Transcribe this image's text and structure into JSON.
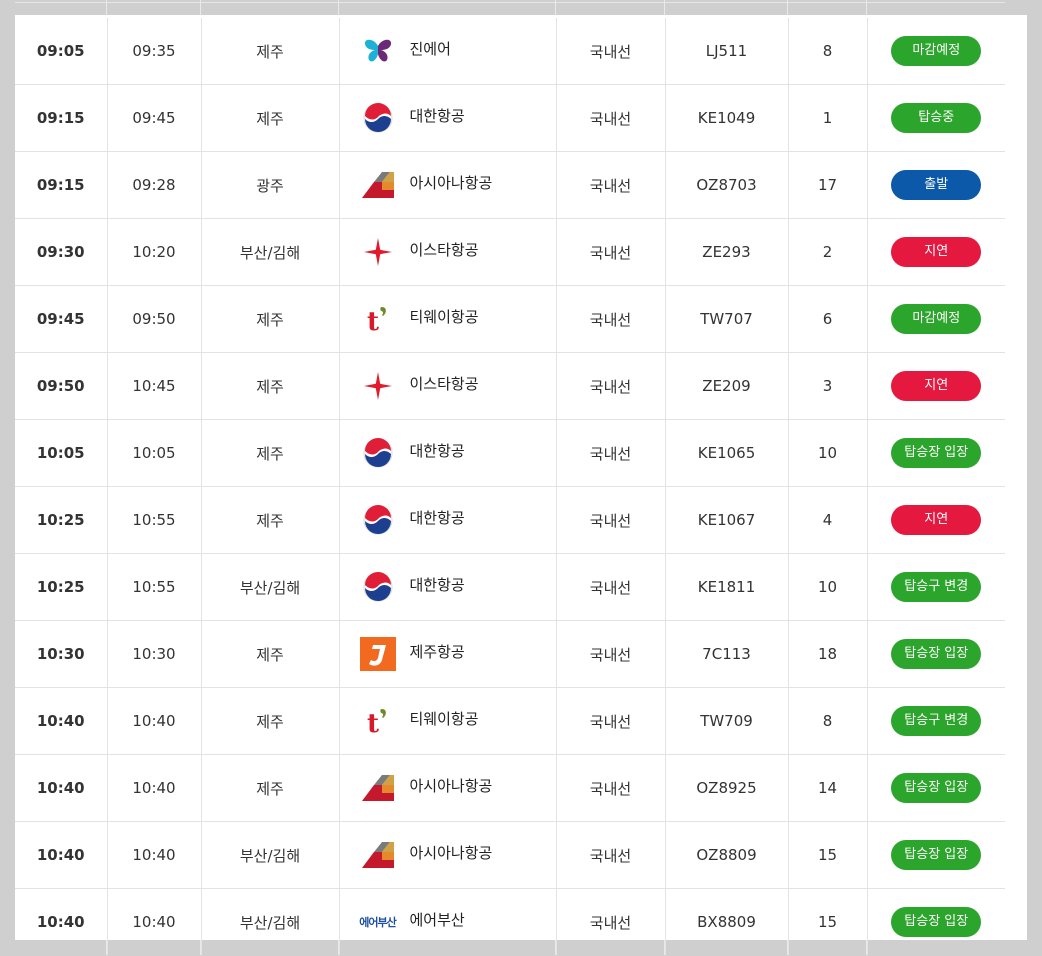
{
  "flights": [
    {
      "scheduled": "09:05",
      "changed": "09:35",
      "destination": "제주",
      "airline": "진에어",
      "logo": "jinair-logo",
      "type": "국내선",
      "flight": "LJ511",
      "gate": "8",
      "status": "마감예정",
      "status_color": "#2ca52c"
    },
    {
      "scheduled": "09:15",
      "changed": "09:45",
      "destination": "제주",
      "airline": "대한항공",
      "logo": "koreanair-logo",
      "type": "국내선",
      "flight": "KE1049",
      "gate": "1",
      "status": "탑승중",
      "status_color": "#2ca52c"
    },
    {
      "scheduled": "09:15",
      "changed": "09:28",
      "destination": "광주",
      "airline": "아시아나항공",
      "logo": "asiana-logo",
      "type": "국내선",
      "flight": "OZ8703",
      "gate": "17",
      "status": "출발",
      "status_color": "#0b59a8"
    },
    {
      "scheduled": "09:30",
      "changed": "10:20",
      "destination": "부산/김해",
      "airline": "이스타항공",
      "logo": "eastar-logo",
      "type": "국내선",
      "flight": "ZE293",
      "gate": "2",
      "status": "지연",
      "status_color": "#e5193f"
    },
    {
      "scheduled": "09:45",
      "changed": "09:50",
      "destination": "제주",
      "airline": "티웨이항공",
      "logo": "tway-logo",
      "type": "국내선",
      "flight": "TW707",
      "gate": "6",
      "status": "마감예정",
      "status_color": "#2ca52c"
    },
    {
      "scheduled": "09:50",
      "changed": "10:45",
      "destination": "제주",
      "airline": "이스타항공",
      "logo": "eastar-logo",
      "type": "국내선",
      "flight": "ZE209",
      "gate": "3",
      "status": "지연",
      "status_color": "#e5193f"
    },
    {
      "scheduled": "10:05",
      "changed": "10:05",
      "destination": "제주",
      "airline": "대한항공",
      "logo": "koreanair-logo",
      "type": "국내선",
      "flight": "KE1065",
      "gate": "10",
      "status": "탑승장 입장",
      "status_color": "#2ca52c"
    },
    {
      "scheduled": "10:25",
      "changed": "10:55",
      "destination": "제주",
      "airline": "대한항공",
      "logo": "koreanair-logo",
      "type": "국내선",
      "flight": "KE1067",
      "gate": "4",
      "status": "지연",
      "status_color": "#e5193f"
    },
    {
      "scheduled": "10:25",
      "changed": "10:55",
      "destination": "부산/김해",
      "airline": "대한항공",
      "logo": "koreanair-logo",
      "type": "국내선",
      "flight": "KE1811",
      "gate": "10",
      "status": "탑승구 변경",
      "status_color": "#2ca52c"
    },
    {
      "scheduled": "10:30",
      "changed": "10:30",
      "destination": "제주",
      "airline": "제주항공",
      "logo": "jejuair-logo",
      "type": "국내선",
      "flight": "7C113",
      "gate": "18",
      "status": "탑승장 입장",
      "status_color": "#2ca52c"
    },
    {
      "scheduled": "10:40",
      "changed": "10:40",
      "destination": "제주",
      "airline": "티웨이항공",
      "logo": "tway-logo",
      "type": "국내선",
      "flight": "TW709",
      "gate": "8",
      "status": "탑승구 변경",
      "status_color": "#2ca52c"
    },
    {
      "scheduled": "10:40",
      "changed": "10:40",
      "destination": "제주",
      "airline": "아시아나항공",
      "logo": "asiana-logo",
      "type": "국내선",
      "flight": "OZ8925",
      "gate": "14",
      "status": "탑승장 입장",
      "status_color": "#2ca52c"
    },
    {
      "scheduled": "10:40",
      "changed": "10:40",
      "destination": "부산/김해",
      "airline": "아시아나항공",
      "logo": "asiana-logo",
      "type": "국내선",
      "flight": "OZ8809",
      "gate": "15",
      "status": "탑승장 입장",
      "status_color": "#2ca52c"
    },
    {
      "scheduled": "10:40",
      "changed": "10:40",
      "destination": "부산/김해",
      "airline": "에어부산",
      "logo": "airbusan-logo",
      "logo_text": "에어부산",
      "type": "국내선",
      "flight": "BX8809",
      "gate": "15",
      "status": "탑승장 입장",
      "status_color": "#2ca52c"
    }
  ]
}
